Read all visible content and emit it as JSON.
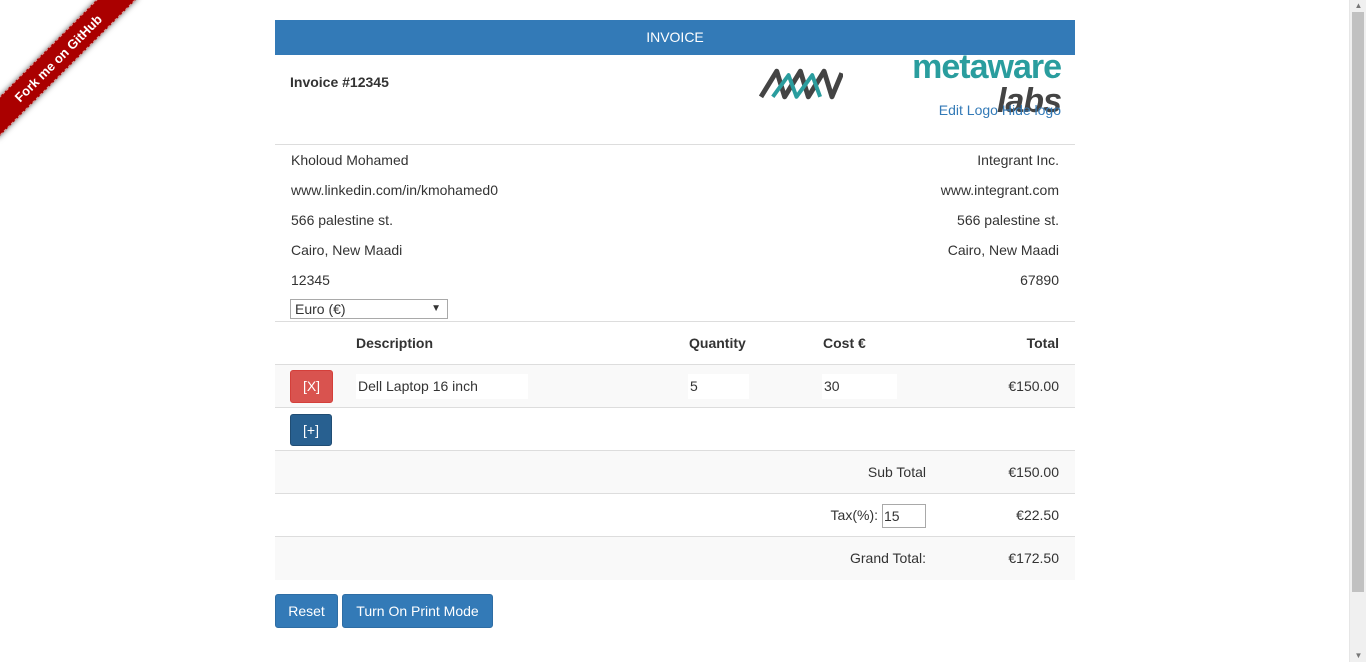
{
  "ribbon": {
    "label": "Fork me on GitHub"
  },
  "header": {
    "title": "INVOICE"
  },
  "invoice": {
    "prefix": "Invoice #",
    "number": "12345"
  },
  "logo": {
    "word1": "metaware",
    "word2": " labs",
    "edit_label": "Edit Logo",
    "hide_label": "Hide logo"
  },
  "from": {
    "name": "Kholoud Mohamed",
    "website": "www.linkedin.com/in/kmohamed0",
    "street": "566 palestine st.",
    "city": "Cairo, New Maadi",
    "zip": "12345"
  },
  "to": {
    "name": "Integrant Inc.",
    "website": "www.integrant.com",
    "street": "566 palestine st.",
    "city": "Cairo, New Maadi",
    "zip": "67890"
  },
  "currency": {
    "selected": "Euro (€)"
  },
  "table": {
    "headers": {
      "description": "Description",
      "quantity": "Quantity",
      "cost": "Cost €",
      "total": "Total"
    },
    "items": [
      {
        "remove_label": "[X]",
        "description": "Dell Laptop 16 inch",
        "quantity": "5",
        "cost": "30",
        "total": "€150.00"
      }
    ],
    "add_label": "[+]"
  },
  "totals": {
    "subtotal_label": "Sub Total",
    "subtotal": "€150.00",
    "tax_label": "Tax(%):",
    "tax_rate": "15",
    "tax": "€22.50",
    "grand_label": "Grand Total:",
    "grand": "€172.50"
  },
  "actions": {
    "reset_label": "Reset",
    "print_label": "Turn On Print Mode"
  },
  "colors": {
    "primary": "#337ab7",
    "danger": "#d9534f",
    "ribbon": "#aa0000",
    "logo_teal": "#2a9d9e"
  }
}
